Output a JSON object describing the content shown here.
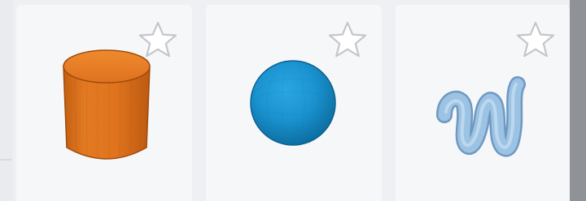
{
  "gallery": {
    "cards": [
      {
        "name": "shape-cylinder",
        "icon": "cylinder-shape-icon",
        "color": "#e0741e",
        "favorite": false
      },
      {
        "name": "shape-sphere",
        "icon": "sphere-shape-icon",
        "color": "#1a92cf",
        "favorite": false
      },
      {
        "name": "shape-scribble",
        "icon": "scribble-shape-icon",
        "color": "#9cc3e4",
        "favorite": false
      }
    ],
    "favorite_icon": "star-outline-icon",
    "colors": {
      "card_bg": "#f6f7f9",
      "page_bg": "#eef0f3",
      "star_stroke": "#c3c6cb",
      "scrollbar": "#8f9397"
    }
  }
}
